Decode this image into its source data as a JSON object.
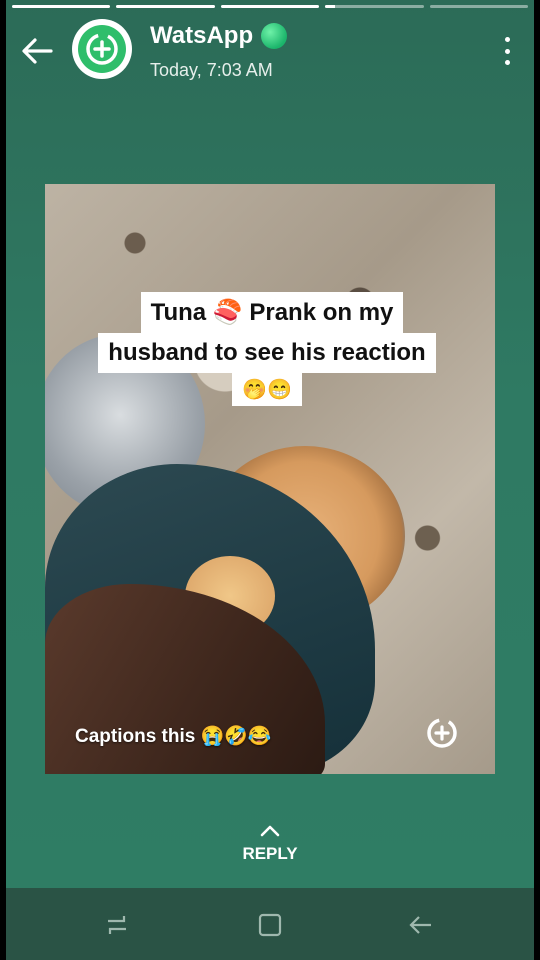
{
  "header": {
    "app_name": "WatsApp",
    "timestamp": "Today, 7:03 AM"
  },
  "progress_segments": [
    {
      "state": "done",
      "fill_fraction": 1.0
    },
    {
      "state": "done",
      "fill_fraction": 1.0
    },
    {
      "state": "done",
      "fill_fraction": 1.0
    },
    {
      "state": "current",
      "fill_fraction": 0.1
    },
    {
      "state": "pending",
      "fill_fraction": 0.0
    }
  ],
  "media": {
    "caption_line1": "Tuna 🍣 Prank  on my",
    "caption_line2": "husband to see his reaction",
    "caption_emoji": "🤭😁",
    "bottom_text": "Captions this 😭🤣😂"
  },
  "reply": {
    "label": "REPLY"
  },
  "icons": {
    "back": "arrow-left-icon",
    "avatar": "status-add-icon",
    "menu": "more-vertical-icon",
    "add": "status-add-icon",
    "reply": "chevron-up-icon",
    "nav_recent": "recent-apps-icon",
    "nav_home": "home-icon",
    "nav_back": "back-arrow-icon"
  },
  "colors": {
    "background": "#2f7a63",
    "accent_green": "#1bb56b",
    "navbar": "#2a5345"
  }
}
